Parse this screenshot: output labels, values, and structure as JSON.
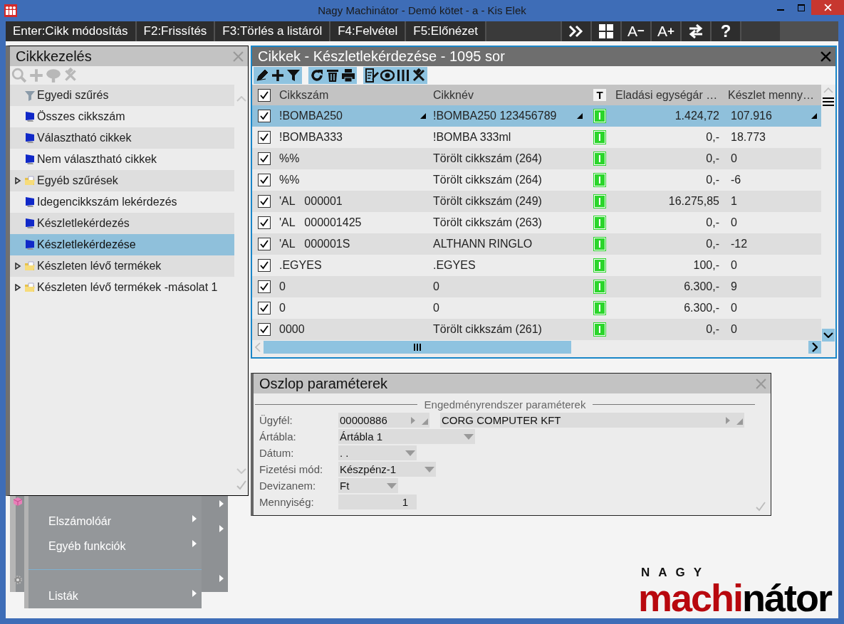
{
  "window": {
    "title": "Nagy Machinátor - Demó kötet - a - Kis Elek"
  },
  "toolbar": {
    "function_keys": [
      "Enter:Cikk módosítás",
      "F2:Frissítés",
      "F3:Törlés a listáról",
      "F4:Felvétel",
      "F5:Előnézet"
    ],
    "font_buttons": [
      {
        "letter": "A",
        "sign": "−"
      },
      {
        "letter": "A",
        "sign": "+"
      }
    ],
    "help_button": "?"
  },
  "side_panel": {
    "title": "Cikkkezelés",
    "items": [
      {
        "label": "Egyedi szűrés",
        "kind": "filter",
        "selected": false
      },
      {
        "label": "Összes cikkszám",
        "kind": "query",
        "selected": false
      },
      {
        "label": "Választható cikkek",
        "kind": "query",
        "selected": false
      },
      {
        "label": "Nem választható cikkek",
        "kind": "query",
        "selected": false
      },
      {
        "label": "Egyéb szűrések",
        "kind": "folder",
        "expanded": false,
        "selected": false
      },
      {
        "label": "Idegencikkszám lekérdezés",
        "kind": "query",
        "selected": false
      },
      {
        "label": "Készletlekérdezés",
        "kind": "query",
        "selected": false
      },
      {
        "label": "Készletlekérdezése",
        "kind": "query",
        "selected": true
      },
      {
        "label": "Készleten lévő termékek",
        "kind": "folder",
        "expanded": false,
        "selected": false
      },
      {
        "label": "Készleten lévő termékek -másolat 1",
        "kind": "folder",
        "expanded": false,
        "selected": false
      }
    ]
  },
  "grid_panel": {
    "title": "Cikkek - Készletlekérdezése - 1095 sor",
    "header_checked": true,
    "columns": [
      "Cikkszám",
      "Cikknév",
      "T",
      "Eladási egységár …",
      "Készlet menny…"
    ],
    "rows": [
      {
        "checked": true,
        "selected": true,
        "code": "!BOMBA250",
        "name": "!BOMBA250 123456789",
        "type": "I",
        "price": "1.424,72",
        "stock": "107.916"
      },
      {
        "checked": true,
        "selected": false,
        "code": "!BOMBA333",
        "name": "!BOMBA 333ml",
        "type": "I",
        "price": "0,-",
        "stock": "18.773"
      },
      {
        "checked": true,
        "selected": false,
        "code": "%%",
        "name": "Törölt cikkszám (264)",
        "type": "I",
        "price": "0,-",
        "stock": "0"
      },
      {
        "checked": true,
        "selected": false,
        "code": "%%",
        "name": "Törölt cikkszám (264)",
        "type": "I",
        "price": "0,-",
        "stock": "-6"
      },
      {
        "checked": true,
        "selected": false,
        "code": "'AL   000001",
        "name": "Törölt cikkszám (249)",
        "type": "I",
        "price": "16.275,85",
        "stock": "1"
      },
      {
        "checked": true,
        "selected": false,
        "code": "'AL   000001425",
        "name": "Törölt cikkszám (263)",
        "type": "I",
        "price": "0,-",
        "stock": "0"
      },
      {
        "checked": true,
        "selected": false,
        "code": "'AL   000001S",
        "name": "ALTHANN RINGLO",
        "type": "I",
        "price": "0,-",
        "stock": "-12"
      },
      {
        "checked": true,
        "selected": false,
        "code": ".EGYES",
        "name": ".EGYES",
        "type": "I",
        "price": "100,-",
        "stock": "0"
      },
      {
        "checked": true,
        "selected": false,
        "code": "0",
        "name": "0",
        "type": "I",
        "price": "6.300,-",
        "stock": "9"
      },
      {
        "checked": true,
        "selected": false,
        "code": "0",
        "name": "0",
        "type": "I",
        "price": "6.300,-",
        "stock": "0"
      },
      {
        "checked": true,
        "selected": false,
        "code": "0000",
        "name": "Törölt cikkszám (261)",
        "type": "I",
        "price": "0,-",
        "stock": "0"
      }
    ]
  },
  "params_panel": {
    "title": "Oszlop paraméterek",
    "section": "Engedményrendszer paraméterek",
    "fields": [
      {
        "label": "Ügyfél:",
        "kind": "lookup",
        "value": "00000886",
        "name": "CORG COMPUTER KFT"
      },
      {
        "label": "Ártábla:",
        "kind": "dropdown",
        "value": "Ártábla 1"
      },
      {
        "label": "Dátum:",
        "kind": "dropdown",
        "value": ".  ."
      },
      {
        "label": "Fizetési mód:",
        "kind": "dropdown",
        "value": "Készpénz-1"
      },
      {
        "label": "Devizanem:",
        "kind": "dropdown",
        "value": "Ft"
      },
      {
        "label": "Mennyiség:",
        "kind": "number",
        "value": "1"
      }
    ]
  },
  "menu": {
    "items": [
      {
        "kind": "item",
        "label": "Elszámolóár"
      },
      {
        "kind": "item",
        "label": "Egyéb funkciók"
      },
      {
        "kind": "separator"
      },
      {
        "kind": "item",
        "label": "Listák"
      }
    ]
  },
  "logo": {
    "top": "NAGY",
    "red": "machi",
    "black": "nátor"
  }
}
